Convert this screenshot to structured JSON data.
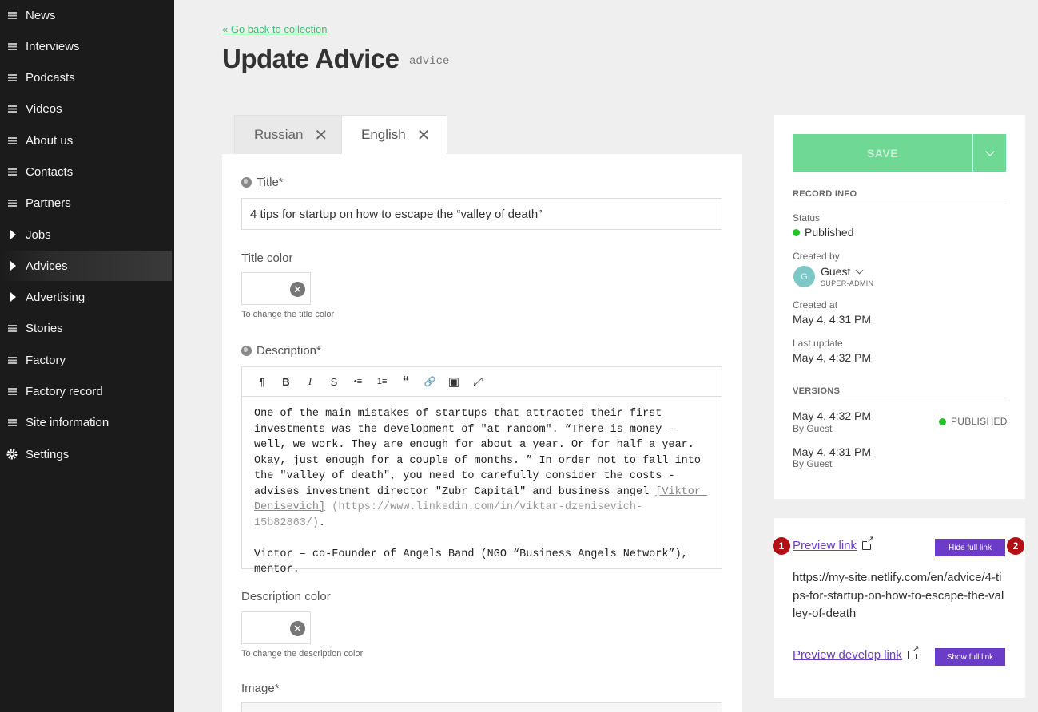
{
  "sidebar": {
    "items": [
      {
        "label": "News",
        "icon": "menu-icon"
      },
      {
        "label": "Interviews",
        "icon": "menu-icon"
      },
      {
        "label": "Podcasts",
        "icon": "menu-icon"
      },
      {
        "label": "Videos",
        "icon": "menu-icon"
      },
      {
        "label": "About us",
        "icon": "menu-icon"
      },
      {
        "label": "Contacts",
        "icon": "menu-icon"
      },
      {
        "label": "Partners",
        "icon": "menu-icon"
      },
      {
        "label": "Jobs",
        "icon": "caret-right-icon"
      },
      {
        "label": "Advices",
        "icon": "caret-right-icon",
        "active": true
      },
      {
        "label": "Advertising",
        "icon": "caret-right-icon"
      },
      {
        "label": "Stories",
        "icon": "menu-icon"
      },
      {
        "label": "Factory",
        "icon": "menu-icon"
      },
      {
        "label": "Factory record",
        "icon": "menu-icon"
      },
      {
        "label": "Site information",
        "icon": "menu-icon"
      },
      {
        "label": "Settings",
        "icon": "gear-icon"
      }
    ]
  },
  "header": {
    "back_link": "« Go back to collection",
    "title": "Update Advice",
    "api_key": "advice"
  },
  "tabs": [
    {
      "label": "Russian",
      "close": "✕"
    },
    {
      "label": "English",
      "close": "✕",
      "active": true
    }
  ],
  "form": {
    "title_label": "Title*",
    "title_value": "4 tips for startup on how  to escape the “valley of death”",
    "title_color_label": "Title color",
    "title_color_hint": "To change the title color",
    "description_label": "Description*",
    "toolbar": [
      "¶",
      "B",
      "I",
      "S",
      "•≡",
      "1≡",
      "“",
      "🔗",
      "▣",
      "⤢"
    ],
    "description_text_1": "One of the main mistakes of startups that attracted their first investments was the development of \"at random\". “There is money - well, we work. They are enough for about a year. Or for half a year. Okay, just enough for a couple of months. ” In order not to fall into the \"valley of death\", you need to carefully consider the costs - advises investment director \"Zubr Capital\" and business angel ",
    "description_link": "[Viktor Denisevich]",
    "description_url": "(https://www.linkedin.com/in/viktar-dzenisevich-15b82863/)",
    "description_text_2": ".\n\nVictor – co-Founder of Angels Band (NGO “Business Angels Network”), mentor.",
    "description_color_label": "Description color",
    "description_color_hint": "To change the description color",
    "image_label": "Image*",
    "clear_glyph": "✕"
  },
  "record": {
    "save_label": "SAVE",
    "record_info_head": "RECORD INFO",
    "status_label": "Status",
    "status_value": "Published",
    "created_by_label": "Created by",
    "creator_initial": "G",
    "creator_name": "Guest",
    "creator_role": "SUPER-ADMIN",
    "created_at_label": "Created at",
    "created_at_value": "May 4, 4:31 PM",
    "last_update_label": "Last update",
    "last_update_value": "May 4, 4:32 PM",
    "versions_head": "VERSIONS",
    "versions": [
      {
        "date": "May 4, 4:32 PM",
        "by": "By Guest",
        "status": "PUBLISHED"
      },
      {
        "date": "May 4, 4:31 PM",
        "by": "By Guest"
      }
    ],
    "status_color": "#27c227"
  },
  "preview": {
    "badge_1": "1",
    "badge_2": "2",
    "preview_link": "Preview link",
    "hide_full_link": "Hide full link",
    "full_url": "https://my-site.netlify.com/en/advice/4-tips-for-startup-on-how-to-escape-the-valley-of-death",
    "preview_develop_link": "Preview develop link",
    "show_full_link": "Show full link"
  },
  "colors": {
    "accent_green": "#6fd894",
    "purple": "#6b3cc7",
    "badge_red": "#b30f14"
  }
}
